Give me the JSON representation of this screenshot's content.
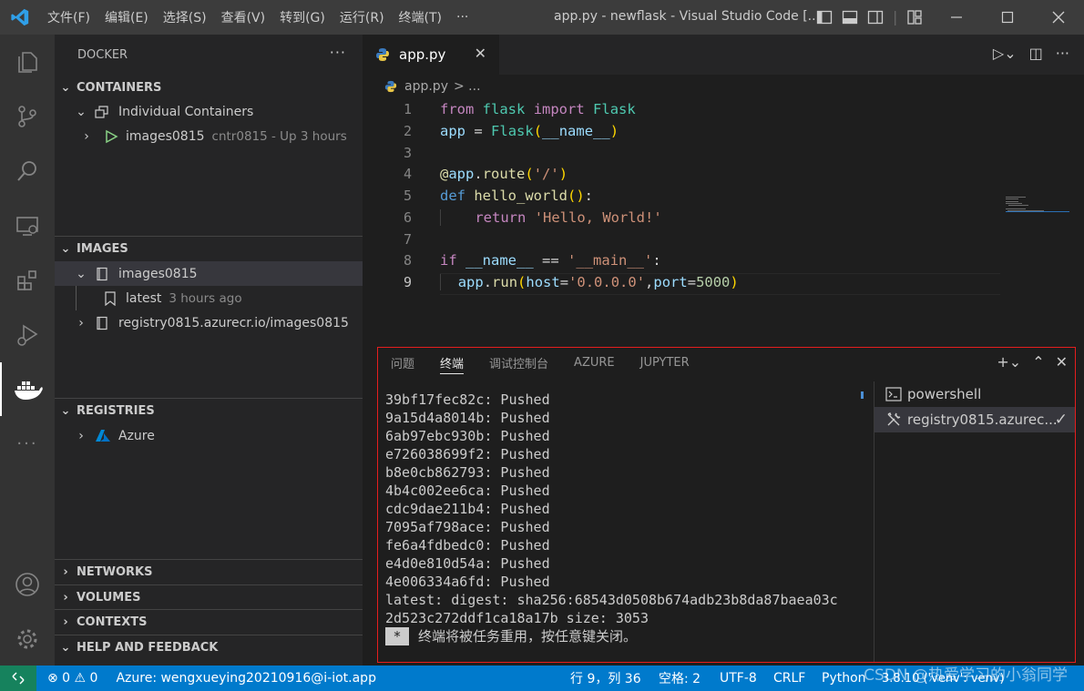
{
  "titlebar": {
    "menus": [
      "文件(F)",
      "编辑(E)",
      "选择(S)",
      "查看(V)",
      "转到(G)",
      "运行(R)",
      "终端(T)",
      "···"
    ],
    "title": "app.py - newflask - Visual Studio Code [..."
  },
  "sidebar": {
    "view_title": "DOCKER",
    "containers": {
      "header": "CONTAINERS",
      "group": "Individual Containers",
      "item_name": "images0815",
      "item_status": "cntr0815 - Up 3 hours"
    },
    "images": {
      "header": "IMAGES",
      "repo": "images0815",
      "tag": "latest",
      "tag_age": "3 hours ago",
      "registry_repo": "registry0815.azurecr.io/images0815"
    },
    "registries": {
      "header": "REGISTRIES",
      "item": "Azure"
    },
    "collapsed_sections": [
      "NETWORKS",
      "VOLUMES",
      "CONTEXTS",
      "HELP AND FEEDBACK"
    ]
  },
  "editor": {
    "tab_label": "app.py",
    "breadcrumb_file": "app.py",
    "breadcrumb_rest": "> ...",
    "line_numbers": [
      "1",
      "2",
      "3",
      "4",
      "5",
      "6",
      "7",
      "8",
      "9"
    ],
    "current_line": 9
  },
  "panel": {
    "tabs": [
      "问题",
      "终端",
      "调试控制台",
      "AZURE",
      "JUPYTER"
    ],
    "active_tab": "终端",
    "terminal_lines": [
      "39bf17fec82c: Pushed",
      "9a15d4a8014b: Pushed",
      "6ab97ebc930b: Pushed",
      "e726038699f2: Pushed",
      "b8e0cb862793: Pushed",
      "4b4c002ee6ca: Pushed",
      "cdc9dae211b4: Pushed",
      "7095af798ace: Pushed",
      "fe6a4fdbedc0: Pushed",
      "e4d0e810d54a: Pushed",
      "4e006334a6fd: Pushed",
      "latest: digest: sha256:68543d0508b674adb23b8da87baea03c",
      "2d523c272ddf1ca18a17b size: 3053"
    ],
    "terminal_final_marker": "*",
    "terminal_final_text": "终端将被任务重用，按任意键关闭。",
    "terminal_instances": [
      "powershell",
      "registry0815.azurec..."
    ]
  },
  "statusbar": {
    "problems": "⊗ 0 ⚠ 0",
    "account": "Azure: wengxueying20210916@i-iot.app",
    "position": "行 9，列 36",
    "indent": "空格: 2",
    "encoding": "UTF-8",
    "eol": "CRLF",
    "language": "Python",
    "interpreter": "3.8.10 ('venv': venv)"
  },
  "watermark": "CSDN @热爱学习的小翁同学",
  "colors": {
    "accent": "#007acc",
    "remote": "#16825d",
    "panel_highlight_border": "#e41e1e"
  }
}
